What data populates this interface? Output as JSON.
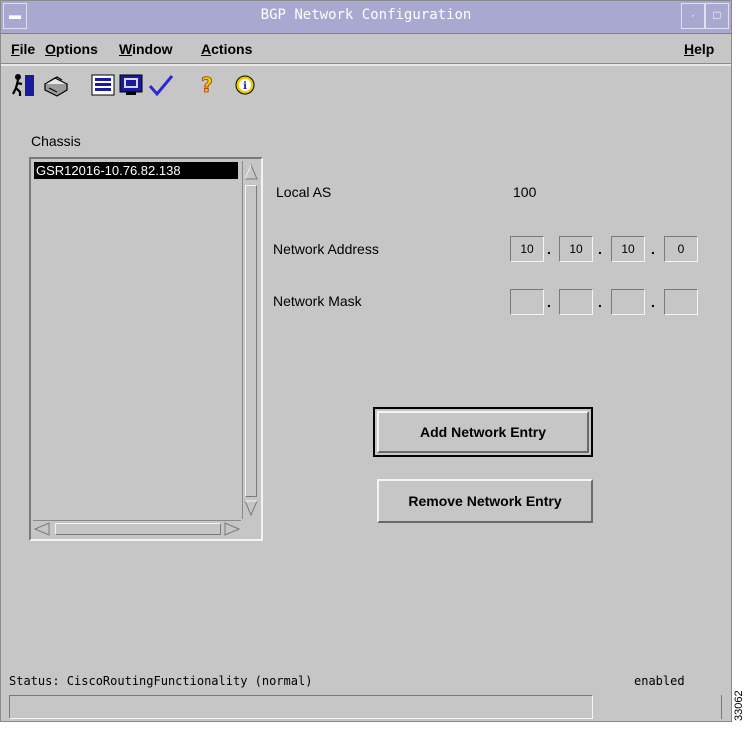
{
  "window": {
    "title": "BGP Network Configuration"
  },
  "menubar": {
    "file": {
      "underline": "F",
      "rest": "ile"
    },
    "options": {
      "underline": "O",
      "rest": "ptions"
    },
    "window": {
      "underline": "W",
      "rest": "indow"
    },
    "actions": {
      "underline": "A",
      "rest": "ctions"
    },
    "help": {
      "underline": "H",
      "rest": "elp"
    }
  },
  "toolbar": {
    "icons": [
      "exit-icon",
      "print-icon",
      "list-icon",
      "monitor-icon",
      "check-icon",
      "help-question-icon",
      "info-icon"
    ],
    "colors": {
      "blue": "#1a1aa0",
      "yellow": "#e8d000",
      "accent": "#a8a8d0"
    }
  },
  "chassis": {
    "label": "Chassis",
    "items": [
      "GSR12016-10.76.82.138"
    ]
  },
  "form": {
    "local_as_label": "Local AS",
    "local_as_value": "100",
    "network_address_label": "Network Address",
    "network_address": [
      "10",
      "10",
      "10",
      "0"
    ],
    "network_mask_label": "Network Mask",
    "network_mask": [
      "",
      "",
      "",
      ""
    ]
  },
  "buttons": {
    "add": "Add Network Entry",
    "remove": "Remove Network Entry"
  },
  "status": {
    "text": "Status: CiscoRoutingFunctionality (normal)",
    "state": "enabled",
    "field_value": ""
  },
  "figure_code": "33062"
}
